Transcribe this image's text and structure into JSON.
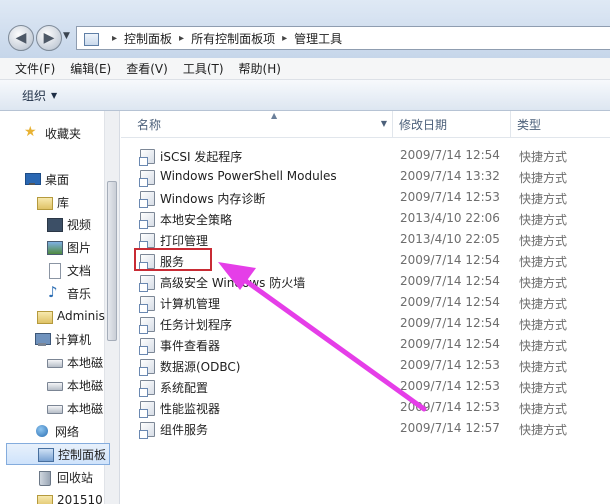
{
  "address": {
    "crumbs": [
      "控制面板",
      "所有控制面板项",
      "管理工具"
    ],
    "separator": "▸"
  },
  "menu": [
    {
      "label": "文件(F)"
    },
    {
      "label": "编辑(E)"
    },
    {
      "label": "查看(V)"
    },
    {
      "label": "工具(T)"
    },
    {
      "label": "帮助(H)"
    }
  ],
  "command": {
    "organize": "组织"
  },
  "nav": [
    {
      "label": "收藏夹",
      "icon": "star-icon"
    },
    {
      "label": "桌面",
      "icon": "desktop-icon"
    },
    {
      "label": "库",
      "icon": "library-icon"
    },
    {
      "label": "视频",
      "icon": "video-icon"
    },
    {
      "label": "图片",
      "icon": "pictures-icon"
    },
    {
      "label": "文档",
      "icon": "documents-icon"
    },
    {
      "label": "音乐",
      "icon": "music-icon"
    },
    {
      "label": "Adminis",
      "icon": "user-folder-icon"
    },
    {
      "label": "计算机",
      "icon": "computer-icon"
    },
    {
      "label": "本地磁",
      "icon": "disk-icon"
    },
    {
      "label": "本地磁",
      "icon": "disk-icon"
    },
    {
      "label": "本地磁",
      "icon": "disk-icon"
    },
    {
      "label": "网络",
      "icon": "network-icon"
    },
    {
      "label": "控制面板",
      "icon": "control-panel-icon"
    },
    {
      "label": "回收站",
      "icon": "recycle-bin-icon"
    },
    {
      "label": "201510",
      "icon": "folder-icon"
    }
  ],
  "columns": {
    "name": "名称",
    "date": "修改日期",
    "type": "类型"
  },
  "files": [
    {
      "name": "iSCSI 发起程序",
      "date": "2009/7/14 12:54",
      "type": "快捷方式"
    },
    {
      "name": "Windows PowerShell Modules",
      "date": "2009/7/14 13:32",
      "type": "快捷方式"
    },
    {
      "name": "Windows 内存诊断",
      "date": "2009/7/14 12:53",
      "type": "快捷方式"
    },
    {
      "name": "本地安全策略",
      "date": "2013/4/10 22:06",
      "type": "快捷方式"
    },
    {
      "name": "打印管理",
      "date": "2013/4/10 22:05",
      "type": "快捷方式"
    },
    {
      "name": "服务",
      "date": "2009/7/14 12:54",
      "type": "快捷方式"
    },
    {
      "name": "高级安全 Windows 防火墙",
      "date": "2009/7/14 12:54",
      "type": "快捷方式"
    },
    {
      "name": "计算机管理",
      "date": "2009/7/14 12:54",
      "type": "快捷方式"
    },
    {
      "name": "任务计划程序",
      "date": "2009/7/14 12:54",
      "type": "快捷方式"
    },
    {
      "name": "事件查看器",
      "date": "2009/7/14 12:54",
      "type": "快捷方式"
    },
    {
      "name": "数据源(ODBC)",
      "date": "2009/7/14 12:53",
      "type": "快捷方式"
    },
    {
      "name": "系统配置",
      "date": "2009/7/14 12:53",
      "type": "快捷方式"
    },
    {
      "name": "性能监视器",
      "date": "2009/7/14 12:53",
      "type": "快捷方式"
    },
    {
      "name": "组件服务",
      "date": "2009/7/14 12:57",
      "type": "快捷方式"
    }
  ],
  "colors": {
    "highlight": "#c82b34",
    "arrow": "#e53ee8"
  }
}
